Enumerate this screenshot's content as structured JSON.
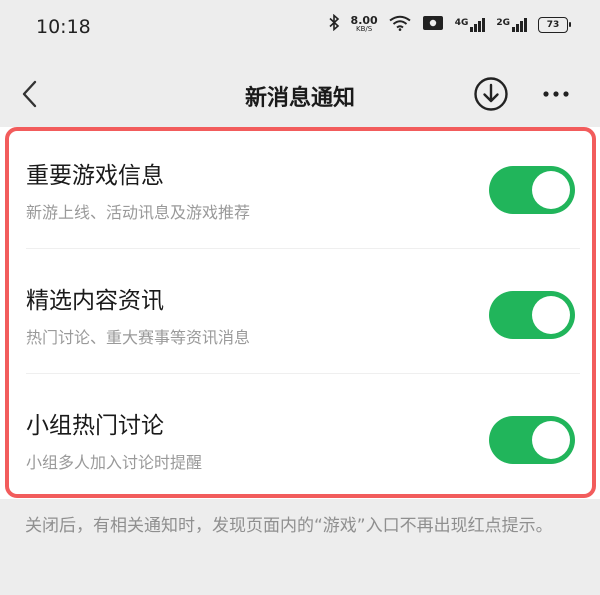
{
  "status_bar": {
    "time": "10:18",
    "speed_value": "8.00",
    "speed_unit": "KB/S",
    "signal_1_label": "4G",
    "signal_2_label": "2G",
    "battery_level": "73"
  },
  "nav": {
    "title": "新消息通知",
    "back_icon": "chevron-left-icon",
    "download_icon": "download-circle-icon",
    "more_icon": "more-dots-icon"
  },
  "settings": [
    {
      "title": "重要游戏信息",
      "description": "新游上线、活动讯息及游戏推荐",
      "enabled": true
    },
    {
      "title": "精选内容资讯",
      "description": "热门讨论、重大赛事等资讯消息",
      "enabled": true
    },
    {
      "title": "小组热门讨论",
      "description": "小组多人加入讨论时提醒",
      "enabled": true
    }
  ],
  "footer_note": "关闭后，有相关通知时，发现页面内的“游戏”入口不再出现红点提示。",
  "colors": {
    "toggle_on": "#21b55b",
    "highlight_frame": "#f25c5c",
    "background": "#ededed"
  }
}
